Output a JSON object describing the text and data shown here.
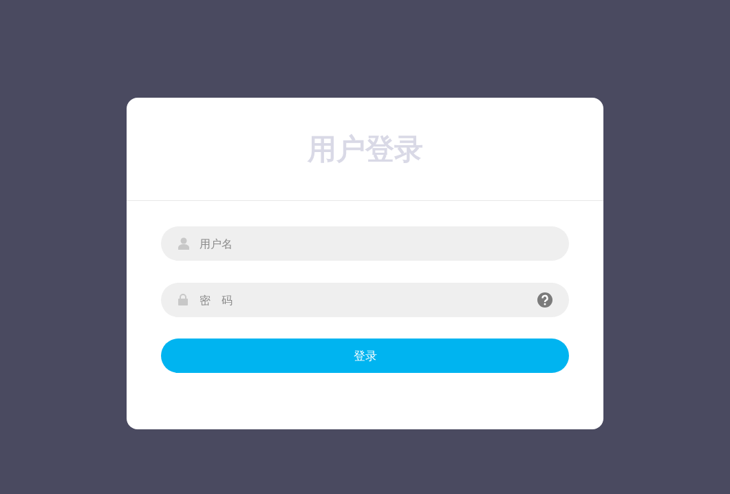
{
  "title": "用户登录",
  "fields": [
    {
      "kind": "text",
      "placeholder": "用户名",
      "help": false
    },
    {
      "kind": "password",
      "placeholder": "密　码",
      "help": true
    }
  ],
  "submit": {
    "label": "登录"
  }
}
